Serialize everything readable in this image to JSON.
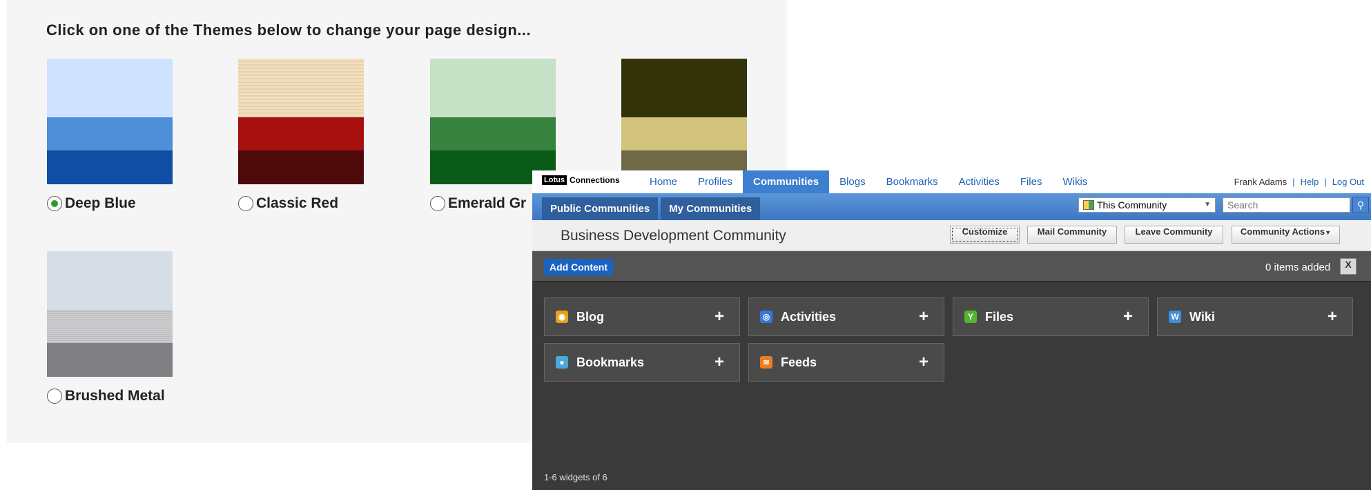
{
  "theme_chooser": {
    "heading": "Click on one of the Themes below to change your page design...",
    "themes": [
      {
        "name": "Deep Blue",
        "selected": true,
        "colors": [
          "#cfe2ff",
          "#4e8fd8",
          "#0f4ea3"
        ]
      },
      {
        "name": "Classic Red",
        "selected": false,
        "colors": [
          "#f1dfbe",
          "#a70e0e",
          "#4e0a0a"
        ]
      },
      {
        "name": "Emerald Gr",
        "selected": false,
        "colors": [
          "#c5e1c6",
          "#388240",
          "#0a5b17"
        ]
      },
      {
        "name": "",
        "selected": false,
        "colors": [
          "#333209",
          "#d1c27c",
          "#6f6945"
        ]
      },
      {
        "name": "Brushed Metal",
        "selected": false,
        "colors": [
          "#d7dde6",
          "#c8c8ca",
          "#808084"
        ]
      }
    ]
  },
  "connections": {
    "logo": {
      "brand": "Lotus",
      "product": "Connections"
    },
    "nav": [
      "Home",
      "Profiles",
      "Communities",
      "Blogs",
      "Bookmarks",
      "Activities",
      "Files",
      "Wikis"
    ],
    "active_nav": "Communities",
    "user": {
      "name": "Frank Adams",
      "help": "Help",
      "logout": "Log Out"
    },
    "subtabs": [
      "Public Communities",
      "My Communities"
    ],
    "search": {
      "scope": "This Community",
      "placeholder": "Search"
    },
    "community_title": "Business Development Community",
    "actions": {
      "customize": "Customize",
      "mail": "Mail Community",
      "leave": "Leave Community",
      "community_actions": "Community Actions"
    },
    "add_content_label": "Add Content",
    "items_added": "0 items added",
    "widgets": [
      {
        "label": "Blog",
        "icon": "blog-icon",
        "color": "#e6a21b"
      },
      {
        "label": "Activities",
        "icon": "activities-icon",
        "color": "#3b77d6"
      },
      {
        "label": "Files",
        "icon": "files-icon",
        "color": "#56b431"
      },
      {
        "label": "Wiki",
        "icon": "wiki-icon",
        "color": "#3c8fd9"
      },
      {
        "label": "Bookmarks",
        "icon": "bookmarks-icon",
        "color": "#4aa9d8"
      },
      {
        "label": "Feeds",
        "icon": "feeds-icon",
        "color": "#ef7a1a"
      }
    ],
    "widget_count": "1-6 widgets of 6",
    "colors": {
      "active_nav": "#3d7fd1",
      "add_content": "#1b63c2",
      "panel_bg": "#3a3a3a"
    }
  }
}
